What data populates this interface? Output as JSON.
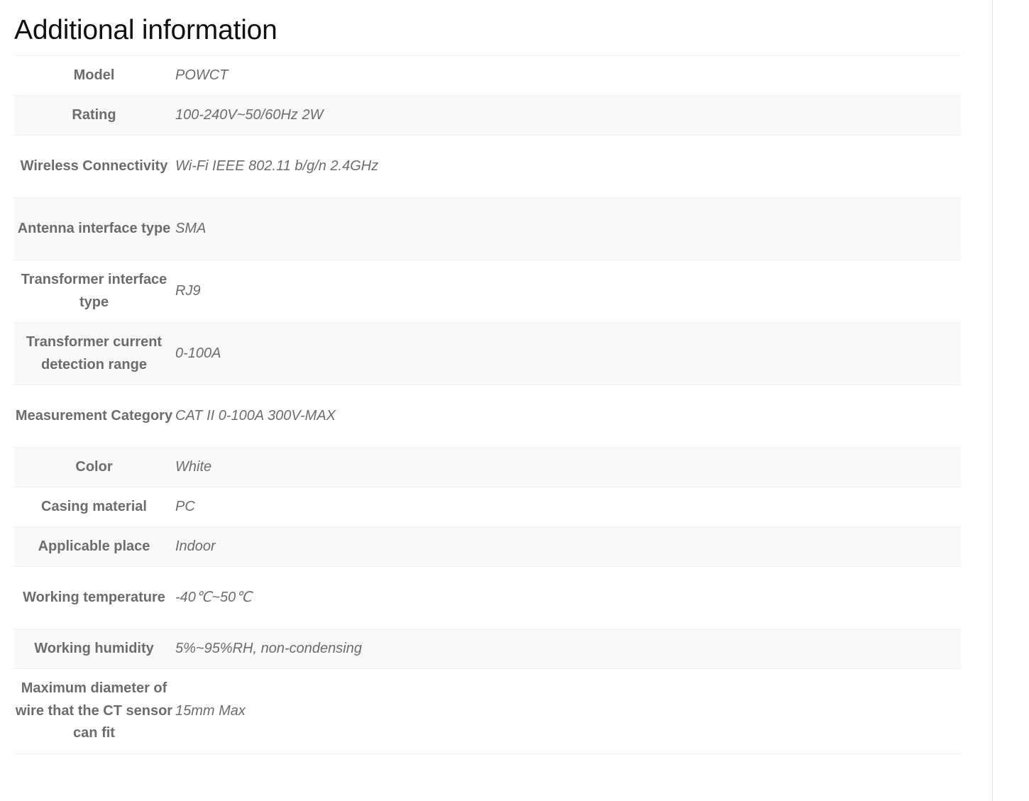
{
  "page": {
    "title": "Additional information"
  },
  "attributes": [
    {
      "label": "Model",
      "value": "POWCT"
    },
    {
      "label": "Rating",
      "value": "100-240V~50/60Hz 2W"
    },
    {
      "label": "Wireless Connectivity",
      "value": "Wi-Fi IEEE 802.11 b/g/n 2.4GHz"
    },
    {
      "label": "Antenna interface type",
      "value": "SMA"
    },
    {
      "label": "Transformer interface type",
      "value": "RJ9"
    },
    {
      "label": "Transformer current detection range",
      "value": "0-100A"
    },
    {
      "label": "Measurement Category",
      "value": "CAT II 0-100A 300V-MAX"
    },
    {
      "label": "Color",
      "value": "White"
    },
    {
      "label": "Casing material",
      "value": "PC"
    },
    {
      "label": "Applicable place",
      "value": "Indoor"
    },
    {
      "label": "Working temperature",
      "value": "-40℃~50℃"
    },
    {
      "label": "Working humidity",
      "value": "5%~95%RH, non-condensing"
    },
    {
      "label": "Maximum diameter of wire that the CT sensor can fit",
      "value": "15mm Max"
    }
  ]
}
